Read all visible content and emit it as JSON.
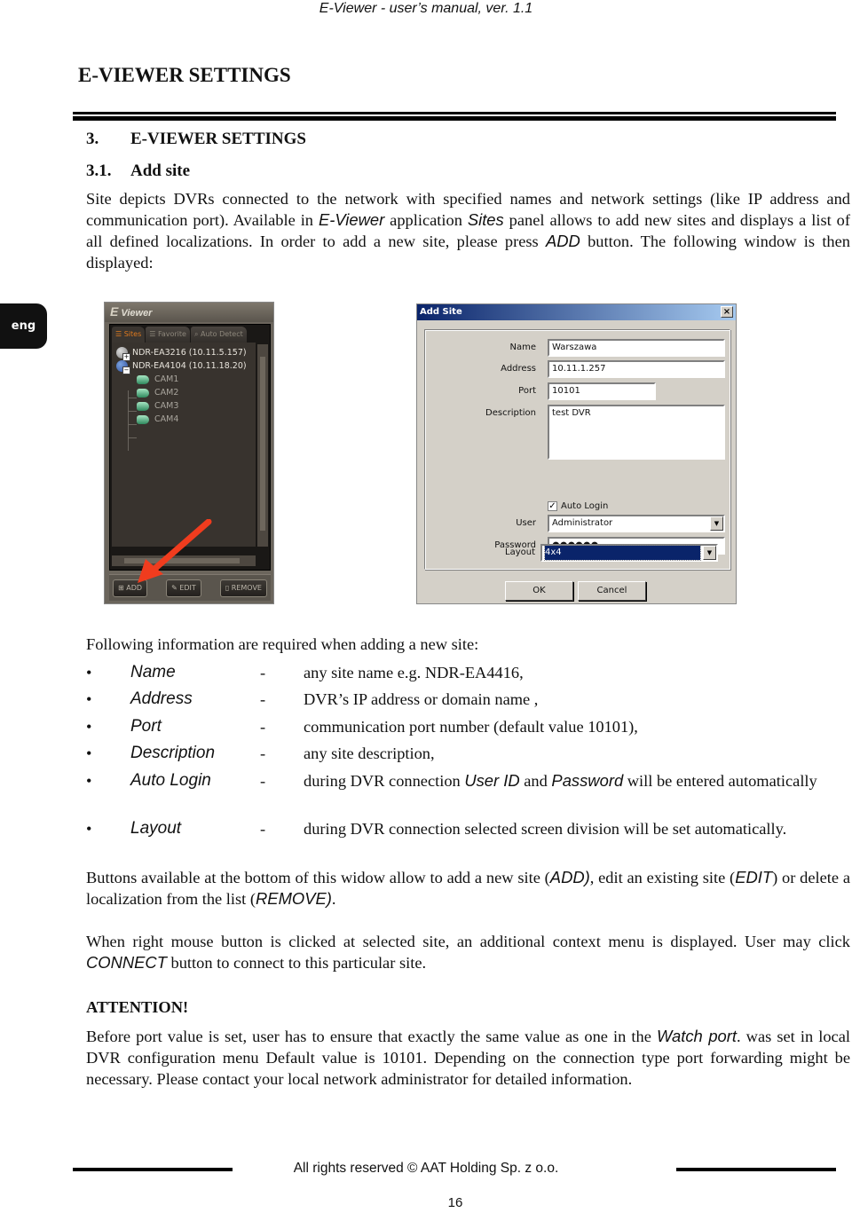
{
  "header": {
    "running_title": "E-Viewer - user’s manual, ver. 1.1"
  },
  "chapter_title": "E-VIEWER SETTINGS",
  "language_tab": "eng",
  "section": {
    "number": "3.",
    "title": "E-VIEWER SETTINGS"
  },
  "subsection": {
    "number": "3.1.",
    "title": "Add site"
  },
  "intro": {
    "p1": "Site depicts DVRs connected to the network with specified names and network settings (like IP address and communication port). Available in ",
    "app_name": "E-Viewer",
    "p2": " application ",
    "panel_name": "Sites",
    "p3": " panel allows to add new sites and displays a list of all defined localizations. In order to add a new site, please press ",
    "button_name": "ADD",
    "p4": " button. The following window is then displayed:"
  },
  "eviewer_panel": {
    "title_letter": "E",
    "title": "Viewer",
    "tabs": [
      {
        "label": "Sites",
        "icon": "list-icon",
        "active": true
      },
      {
        "label": "Favorite",
        "icon": "list-icon",
        "active": false
      },
      {
        "label": "Auto Detect",
        "icon": "search-list-icon",
        "active": false
      }
    ],
    "tree": [
      {
        "label": "NDR-EA3216 (10.11.5.157)",
        "type": "site",
        "expanded": false
      },
      {
        "label": "NDR-EA4104 (10.11.18.20)",
        "type": "site",
        "expanded": true
      },
      {
        "label": "CAM1",
        "type": "camera"
      },
      {
        "label": "CAM2",
        "type": "camera"
      },
      {
        "label": "CAM3",
        "type": "camera"
      },
      {
        "label": "CAM4",
        "type": "camera"
      }
    ],
    "buttons": {
      "add": "ADD",
      "edit": "EDIT",
      "remove": "REMOVE"
    },
    "annotation_color": "#f03c1e"
  },
  "add_site_dialog": {
    "title": "Add Site",
    "close": "×",
    "fields": {
      "name_label": "Name",
      "name_value": "Warszawa",
      "address_label": "Address",
      "address_value": "10.11.1.257",
      "port_label": "Port",
      "port_value": "10101",
      "description_label": "Description",
      "description_value": "test DVR",
      "auto_login_label": "Auto Login",
      "auto_login_checked": true,
      "user_label": "User",
      "user_value": "Administrator",
      "password_label": "Password",
      "password_value": "●●●●●●",
      "layout_label": "Layout",
      "layout_value": "4x4"
    },
    "ok": "OK",
    "cancel": "Cancel"
  },
  "requirements": {
    "intro": "Following information are required when adding a new site:",
    "items": [
      {
        "term": "Name",
        "dash": "-",
        "desc": "any site name e.g. NDR-EA4416,"
      },
      {
        "term": "Address",
        "dash": "-",
        "desc": "DVR’s IP address or domain name ,"
      },
      {
        "term": "Port",
        "dash": "-",
        "desc": "communication port number (default value 10101),"
      },
      {
        "term": "Description",
        "dash": "-",
        "desc": "any site description,"
      },
      {
        "term": "Auto Login",
        "dash": "-",
        "desc_a": "during DVR connection ",
        "desc_b": "User ID",
        "desc_c": " and ",
        "desc_d": "Password",
        "desc_e": " will be entered automatically"
      },
      {
        "term": "Layout",
        "dash": "-",
        "desc": "during DVR connection selected screen division will be set automatically."
      }
    ]
  },
  "buttons_paragraph": {
    "a": "Buttons available at the bottom of this widow allow to add a new site (",
    "add": "ADD)",
    "b": ", edit an existing site (",
    "edit": "EDIT",
    "c": ") or delete a localization from the list (",
    "remove": "REMOVE)",
    "d": "."
  },
  "context_paragraph": {
    "a": "When right mouse button is clicked at selected site, an additional context menu is displayed. User may click ",
    "connect": "CONNECT",
    "b": " button to connect to this particular site."
  },
  "attention": {
    "title": "ATTENTION!",
    "a": "Before port value is set, user has to ensure that exactly the same value as one in the ",
    "watch_port": "Watch port",
    "b": ". was set in local DVR configuration menu Default value is 10101. Depending on the connection type port forwarding might be necessary.  Please contact your local network administrator for detailed information."
  },
  "footer": {
    "copyright": "All rights reserved © AAT Holding Sp. z o.o.",
    "page_number": "16"
  }
}
